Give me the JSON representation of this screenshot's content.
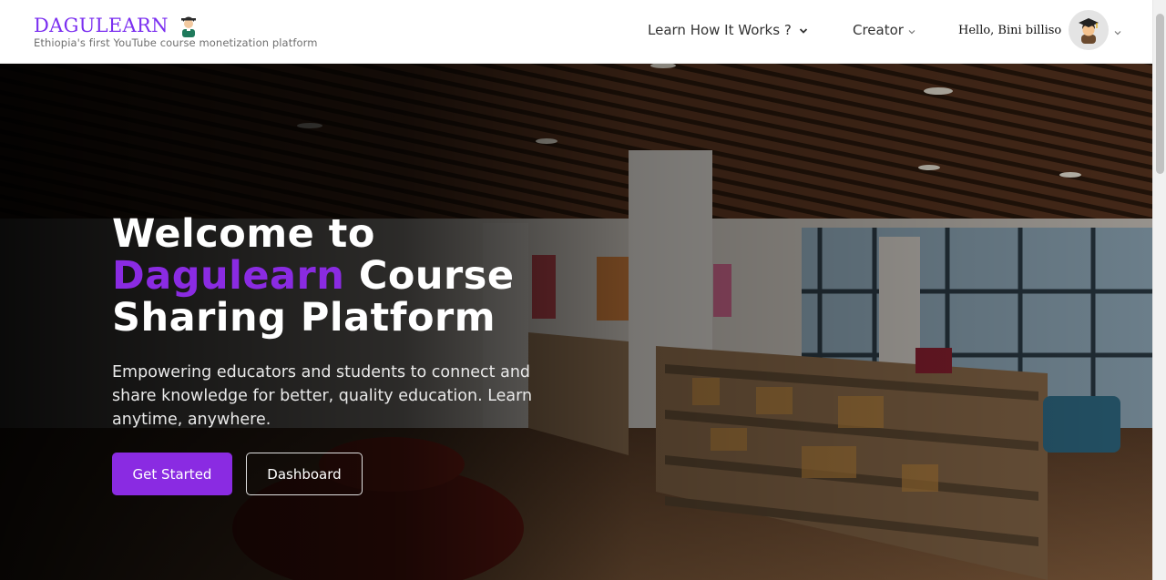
{
  "header": {
    "brand_name": "DAGULEARN",
    "tagline": "Ethiopia's first YouTube course monetization platform",
    "nav": {
      "learn_label": "Learn How It Works ?",
      "creator_label": "Creator"
    },
    "user": {
      "greeting": "Hello, Bini billiso"
    }
  },
  "hero": {
    "title_line1": "Welcome to",
    "title_accent": "Dagulearn",
    "title_rest": " Course",
    "title_line3": "Sharing Platform",
    "subtitle": "Empowering educators and students to connect and share knowledge for better, quality education. Learn anytime, anywhere.",
    "primary_button": "Get Started",
    "secondary_button": "Dashboard"
  },
  "colors": {
    "brand": "#7b2ff0",
    "accent": "#8a2be2",
    "header_bg": "#ffffff"
  },
  "icons": {
    "logo": "graduate-person-icon",
    "avatar": "graduate-avatar-icon",
    "dropdown": "chevron-down-icon"
  }
}
